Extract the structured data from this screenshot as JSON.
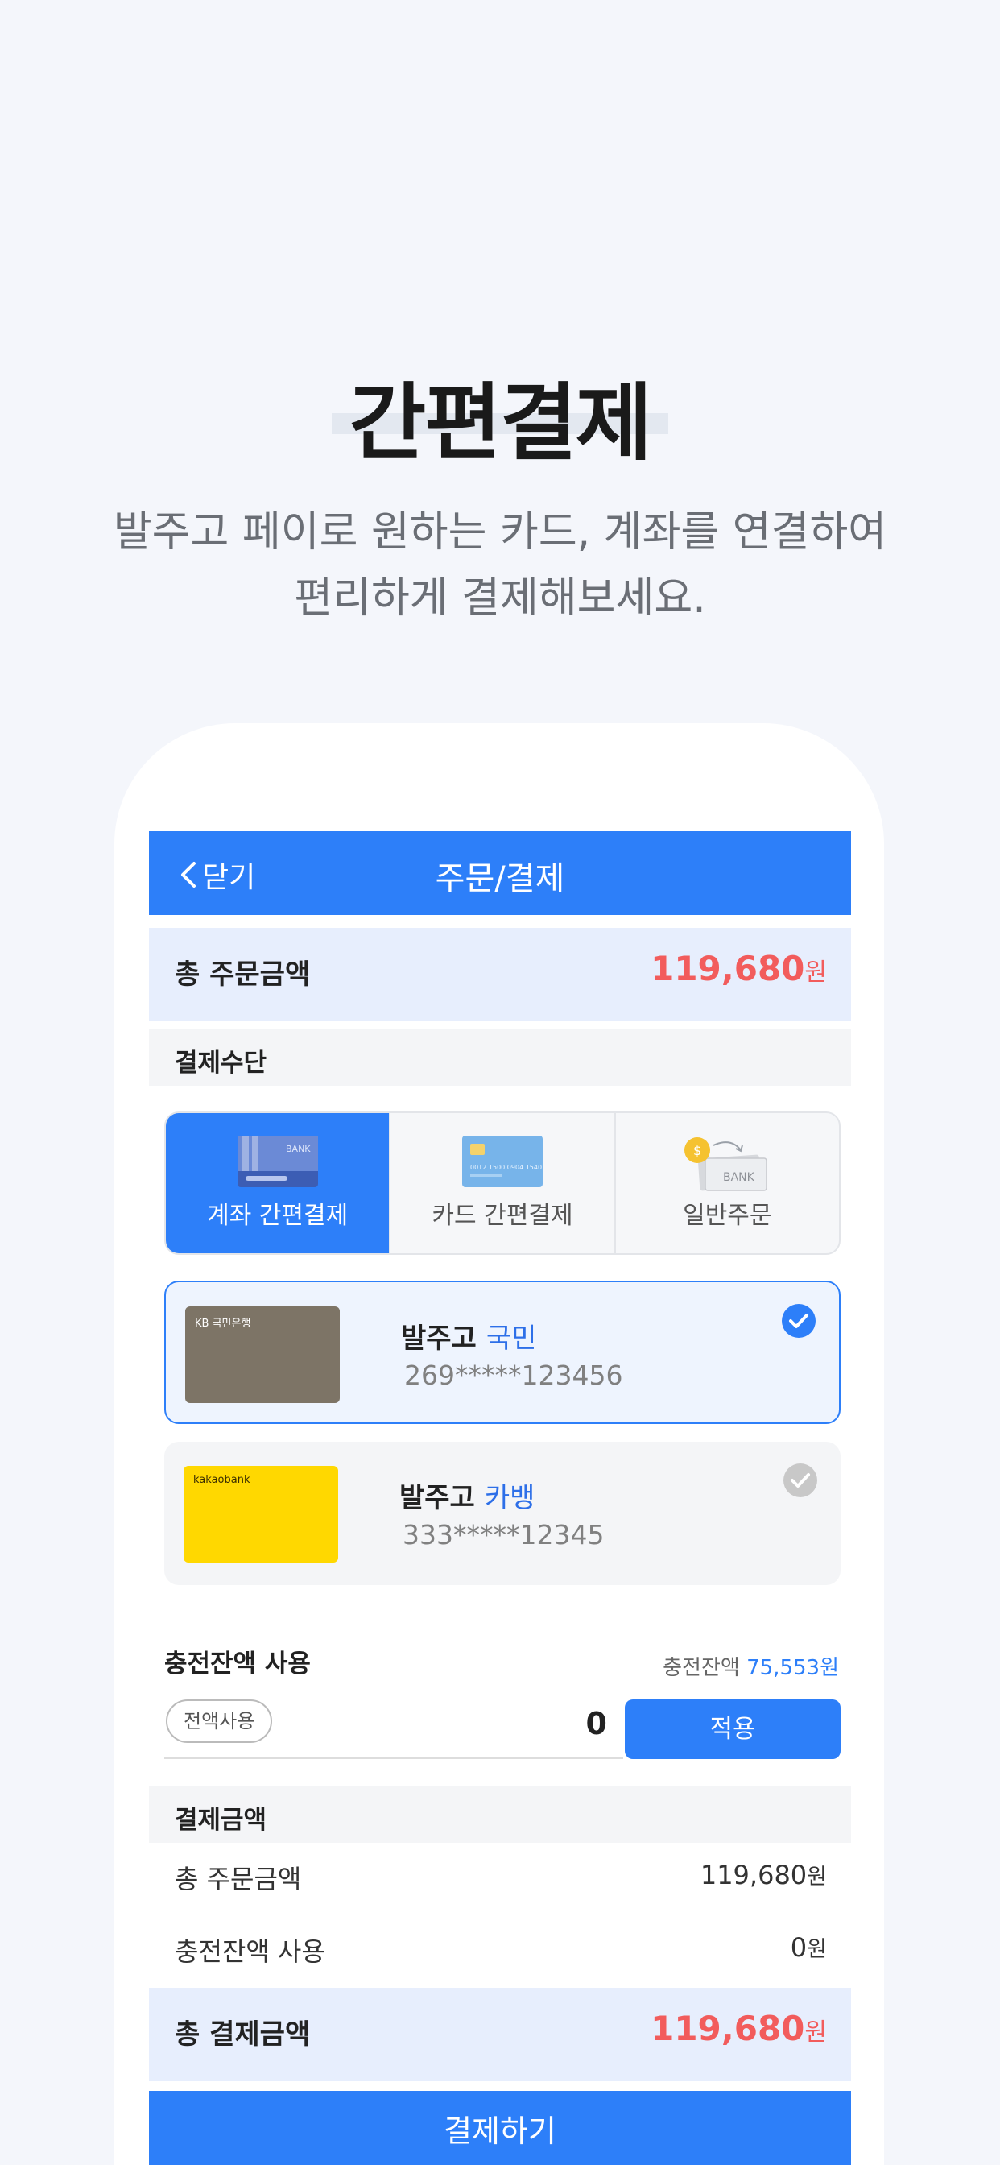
{
  "hero": {
    "title": "간편결제",
    "subtitle_line1": "발주고 페이로 원하는 카드, 계좌를 연결하여",
    "subtitle_line2": "편리하게 결제해보세요."
  },
  "topbar": {
    "back_label": "닫기",
    "title": "주문/결제"
  },
  "order_total": {
    "label": "총 주문금액",
    "amount": "119,680",
    "unit": "원"
  },
  "payment_method": {
    "section_label": "결제수단",
    "tabs": [
      {
        "label": "계좌 간편결제",
        "icon": "bank-card-icon",
        "active": true
      },
      {
        "label": "카드 간편결제",
        "icon": "credit-card-icon",
        "active": false
      },
      {
        "label": "일반주문",
        "icon": "bank-transfer-icon",
        "active": false
      }
    ]
  },
  "accounts": [
    {
      "owner": "발주고",
      "bank": "국민",
      "number": "269*****123456",
      "card_text": "KB 국민은행",
      "card_color": "#7d7466",
      "selected": true
    },
    {
      "owner": "발주고",
      "bank": "카뱅",
      "number": "333*****12345",
      "card_text": "kakaobank",
      "card_color": "#ffd800",
      "selected": false
    }
  ],
  "charge": {
    "label": "충전잔액 사용",
    "balance_label": "충전잔액",
    "balance_value": "75,553원",
    "use_all_label": "전액사용",
    "input_value": "0",
    "apply_label": "적용"
  },
  "payment_summary": {
    "section_label": "결제금액",
    "rows": [
      {
        "label": "총 주문금액",
        "value": "119,680",
        "unit": "원"
      },
      {
        "label": "충전잔액 사용",
        "value": "0",
        "unit": "원"
      }
    ],
    "final_label": "총 결제금액",
    "final_amount": "119,680",
    "final_unit": "원"
  },
  "pay_button_label": "결제하기",
  "colors": {
    "primary": "#2d7ff9",
    "amount_red": "#f25c5c",
    "light_blue_bg": "#e7eefd"
  }
}
